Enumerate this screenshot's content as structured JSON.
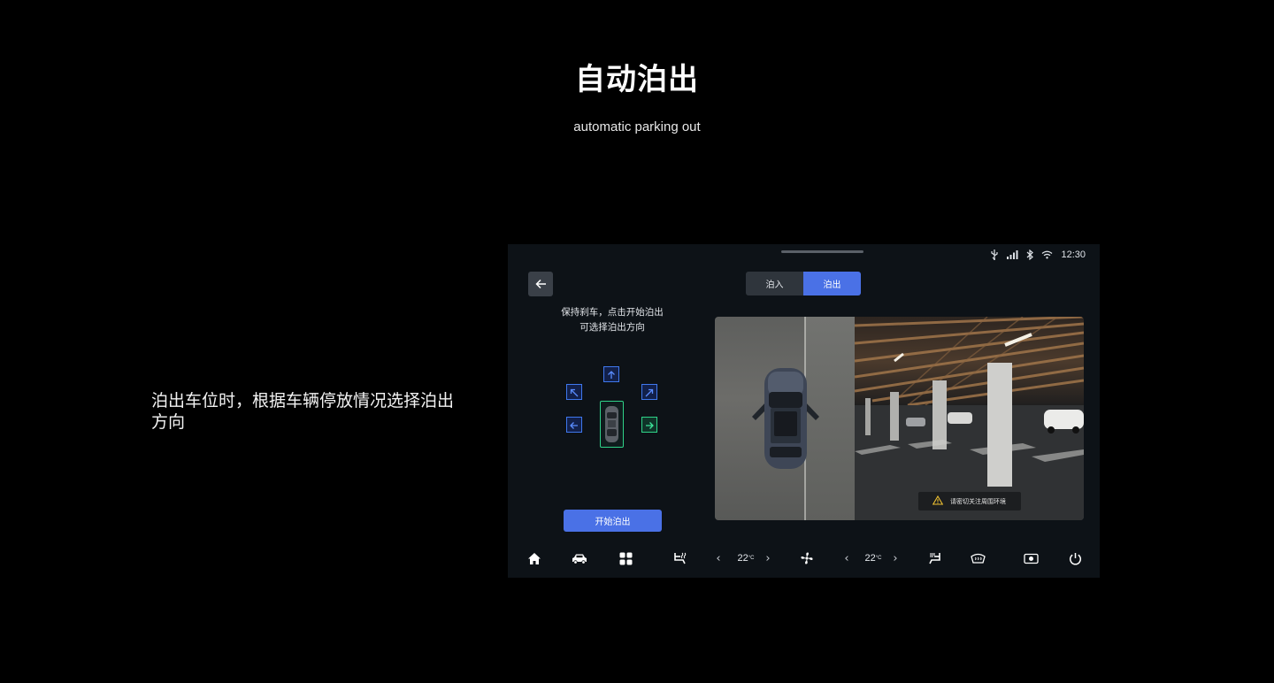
{
  "header": {
    "title": "自动泊出",
    "subtitle": "automatic parking out"
  },
  "description": "泊出车位时，根据车辆停放情况选择泊出方向",
  "screen": {
    "status": {
      "time": "12:30",
      "icons": [
        "usb-icon",
        "signal-icon",
        "bluetooth-icon",
        "wifi-icon"
      ]
    },
    "tabs": [
      {
        "label": "泊入",
        "active": false
      },
      {
        "label": "泊出",
        "active": true
      }
    ],
    "hint": {
      "line1": "保持刹车，点击开始泊出",
      "line2": "可选择泊出方向"
    },
    "directions": [
      "up",
      "up-left",
      "up-right",
      "left",
      "right"
    ],
    "active_direction": "right",
    "start_button": "开始泊出",
    "warning": "请密切关注周围环境",
    "dock": {
      "left_temp": "22",
      "right_temp": "22",
      "temp_unit": "°C"
    },
    "colors": {
      "accent": "#4a71e6",
      "active_direction": "#2fd389",
      "background": "#0d1217"
    }
  }
}
